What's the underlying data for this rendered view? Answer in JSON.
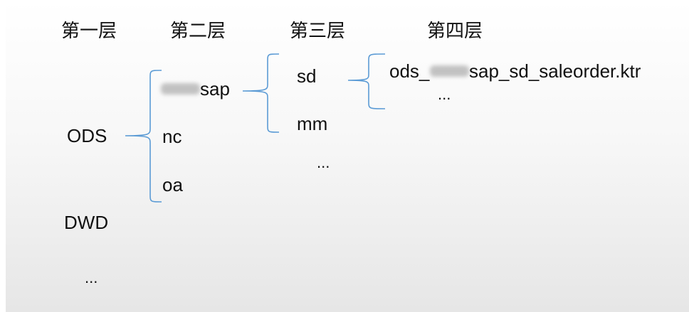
{
  "headers": [
    "第一层",
    "第二层",
    "第三层",
    "第四层"
  ],
  "layer1": {
    "items": [
      "ODS",
      "DWD"
    ],
    "ellipsis": "..."
  },
  "layer2": {
    "items": [
      "sap",
      "nc",
      "oa"
    ]
  },
  "layer3": {
    "items": [
      "sd",
      "mm"
    ],
    "ellipsis": "..."
  },
  "layer4": {
    "prefix": "ods_",
    "suffix": "sap_sd_saleorder.ktr",
    "ellipsis": "..."
  },
  "colors": {
    "bracket": "#5b9bd5",
    "text": "#111111"
  }
}
